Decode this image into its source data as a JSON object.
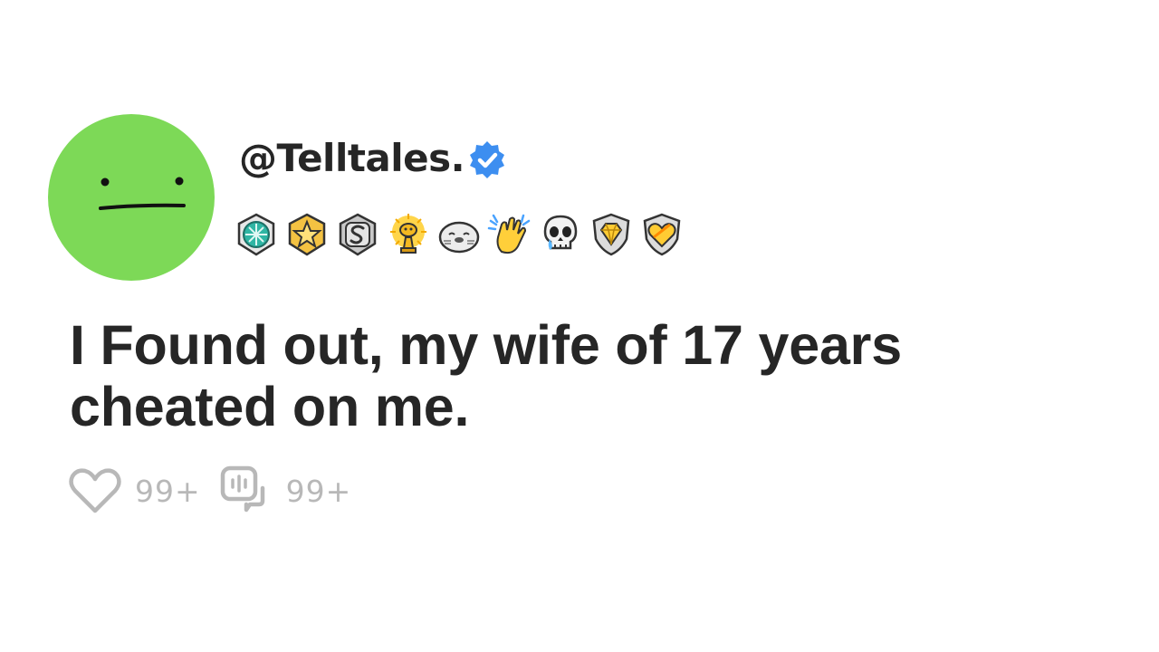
{
  "profile": {
    "avatar": "neutral-face-icon",
    "username": "@Telltales.",
    "verified": true,
    "verified_color": "#3d8ef0",
    "avatar_color": "#7dd957"
  },
  "awards": [
    "helpful-badge-icon",
    "gold-star-badge-icon",
    "silver-s-badge-icon",
    "gold-reddit-trophy-icon",
    "seal-emoji-icon",
    "clapping-hands-icon",
    "crying-skull-icon",
    "gold-diamond-shield-icon",
    "gold-heart-shield-icon"
  ],
  "post": {
    "title": "I Found out, my wife of 17 years cheated on me."
  },
  "actions": {
    "likes": "99+",
    "comments": "99+",
    "icon_color": "#b8b8b8"
  }
}
